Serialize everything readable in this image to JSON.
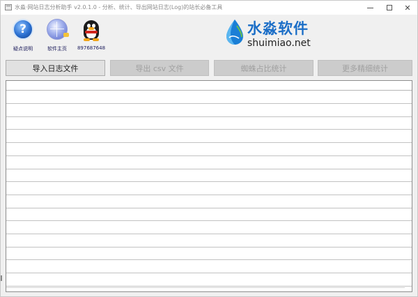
{
  "window": {
    "title": "水淼·网站日志分析助手 v2.0.1.0 - 分析、统计、导出网站日志(Log)的站长必备工具",
    "controls": {
      "minimize": "minimize",
      "maximize": "maximize",
      "close": "✕"
    }
  },
  "toolbar": {
    "items": [
      {
        "label": "疑点说明",
        "icon": "help-question-icon"
      },
      {
        "label": "软件主页",
        "icon": "globe-icon"
      },
      {
        "label": "897687648",
        "icon": "qq-penguin-icon"
      }
    ]
  },
  "logo": {
    "title": "水淼软件",
    "subtitle": "shuimiao.net",
    "color": "#1b6ec7"
  },
  "actions": {
    "import_label": "导入日志文件",
    "export_label": "导出 csv 文件",
    "spider_label": "蜘蛛占比统计",
    "more_label": "更多精细统计"
  },
  "grid": {
    "columns": [],
    "rows": [
      [],
      [],
      [],
      [],
      [],
      [],
      [],
      [],
      [],
      [],
      [],
      [],
      [],
      [],
      [],
      []
    ]
  }
}
